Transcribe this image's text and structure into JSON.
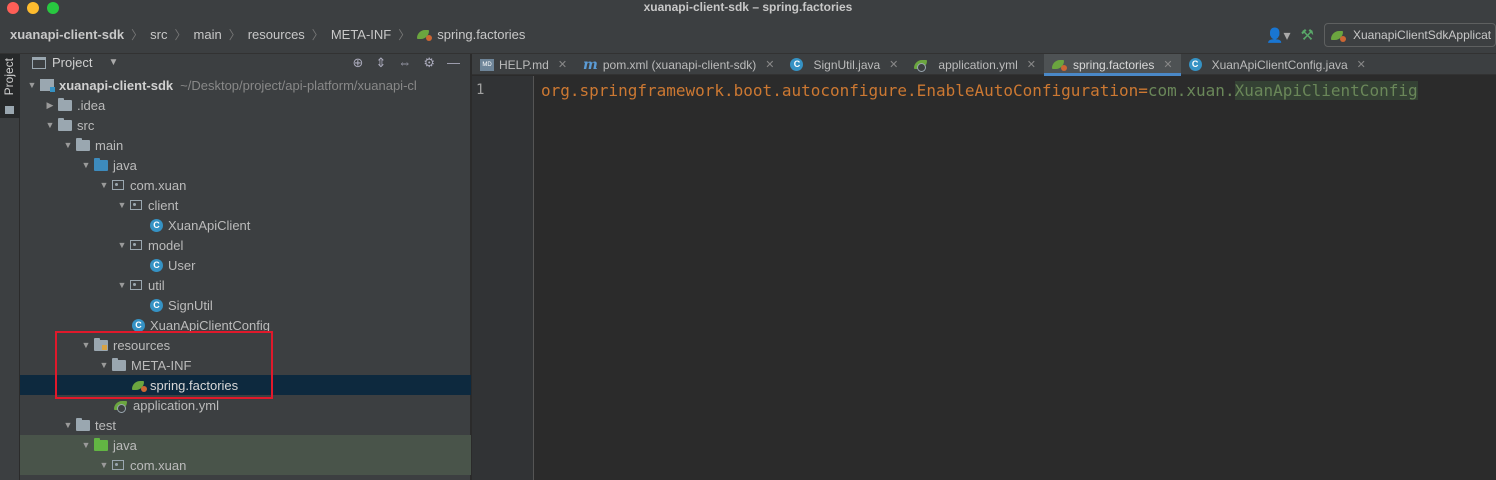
{
  "window": {
    "title": "xuanapi-client-sdk – spring.factories"
  },
  "navbar": {
    "breadcrumbs": [
      "xuanapi-client-sdk",
      "src",
      "main",
      "resources",
      "META-INF",
      "spring.factories"
    ],
    "run_config": "XuanapiClientSdkApplicat"
  },
  "toolstrip": {
    "project_label": "Project"
  },
  "project_panel": {
    "title": "Project",
    "module_path": "~/Desktop/project/api-platform/xuanapi-cl",
    "tree": [
      {
        "label": "xuanapi-client-sdk",
        "depth": 0,
        "expanded": true,
        "type": "module"
      },
      {
        "label": ".idea",
        "depth": 1,
        "expanded": false,
        "type": "folder"
      },
      {
        "label": "src",
        "depth": 1,
        "expanded": true,
        "type": "folder"
      },
      {
        "label": "main",
        "depth": 2,
        "expanded": true,
        "type": "folder"
      },
      {
        "label": "java",
        "depth": 3,
        "expanded": true,
        "type": "source-folder"
      },
      {
        "label": "com.xuan",
        "depth": 4,
        "expanded": true,
        "type": "package"
      },
      {
        "label": "client",
        "depth": 5,
        "expanded": true,
        "type": "package"
      },
      {
        "label": "XuanApiClient",
        "depth": 6,
        "type": "class"
      },
      {
        "label": "model",
        "depth": 5,
        "expanded": true,
        "type": "package"
      },
      {
        "label": "User",
        "depth": 6,
        "type": "class"
      },
      {
        "label": "util",
        "depth": 5,
        "expanded": true,
        "type": "package"
      },
      {
        "label": "SignUtil",
        "depth": 6,
        "type": "class"
      },
      {
        "label": "XuanApiClientConfig",
        "depth": 5,
        "type": "class"
      },
      {
        "label": "resources",
        "depth": 3,
        "expanded": true,
        "type": "resources-folder"
      },
      {
        "label": "META-INF",
        "depth": 4,
        "expanded": true,
        "type": "folder"
      },
      {
        "label": "spring.factories",
        "depth": 5,
        "type": "spring",
        "selected": true
      },
      {
        "label": "application.yml",
        "depth": 4,
        "type": "yml"
      },
      {
        "label": "test",
        "depth": 2,
        "expanded": true,
        "type": "folder"
      },
      {
        "label": "java",
        "depth": 3,
        "expanded": true,
        "type": "test-folder",
        "test": true
      },
      {
        "label": "com.xuan",
        "depth": 4,
        "expanded": true,
        "type": "package",
        "test": true
      }
    ]
  },
  "editor": {
    "tabs": [
      {
        "label": "HELP.md",
        "icon": "markdown-icon",
        "active": false
      },
      {
        "label": "pom.xml (xuanapi-client-sdk)",
        "icon": "maven-icon",
        "active": false
      },
      {
        "label": "SignUtil.java",
        "icon": "class-icon",
        "active": false
      },
      {
        "label": "application.yml",
        "icon": "yml-icon",
        "active": false
      },
      {
        "label": "spring.factories",
        "icon": "spring-icon",
        "active": true
      },
      {
        "label": "XuanApiClientConfig.java",
        "icon": "class-icon",
        "active": false
      }
    ],
    "line_number": "1",
    "code": {
      "key": "org.springframework.boot.autoconfigure.EnableAutoConfiguration",
      "equals": "=",
      "value_prefix": "com.xuan.",
      "value_highlight": "XuanApiClientConfig"
    }
  },
  "colors": {
    "selection": "#0d293e",
    "highlight_box": "#e0192b",
    "active_tab_underline": "#4a88c7",
    "key_color": "#cc7832",
    "value_color": "#6a8759"
  }
}
